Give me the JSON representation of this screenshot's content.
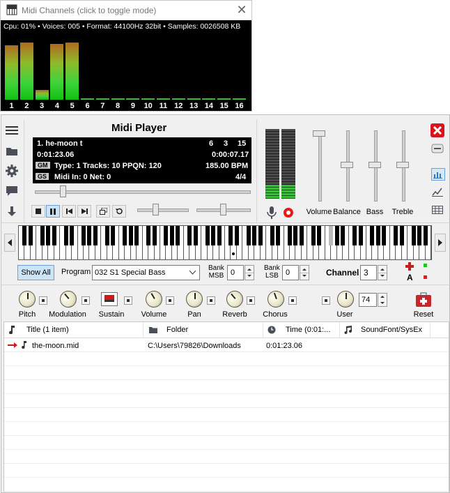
{
  "midi_channels": {
    "title": "Midi Channels (click to toggle mode)",
    "status": "Cpu: 01% • Voices: 005 • Format: 44100Hz 32bit • Samples: 0026508 KB",
    "levels": [
      0.95,
      1.0,
      0.17,
      0.98,
      1.0,
      0,
      0,
      0,
      0,
      0,
      0,
      0,
      0,
      0,
      0,
      0
    ],
    "channels": [
      "1",
      "2",
      "3",
      "4",
      "5",
      "6",
      "7",
      "8",
      "9",
      "10",
      "11",
      "12",
      "13",
      "14",
      "15",
      "16"
    ]
  },
  "player": {
    "title": "Midi Player",
    "song": "1. he-moon   t",
    "nums": [
      "6",
      "3",
      "15"
    ],
    "time_pos": "0:01:23.06",
    "time_remain": "0:00:07.17",
    "gm_tag": "GM",
    "gs_tag": "GS",
    "info_line": "Type: 1  Tracks: 10  PPQN: 120",
    "bpm": "185.00 BPM",
    "midi_line": "Midi In: 0  Net: 0",
    "sig": "4/4",
    "seek_position": 0.12
  },
  "mixer": {
    "labels": [
      "Volume",
      "Balance",
      "Bass",
      "Treble"
    ],
    "positions": [
      0.0,
      0.5,
      0.5,
      0.5
    ]
  },
  "controls": {
    "show_all": "Show All",
    "program_label": "Program",
    "program_value": "032 S1 Special Bass",
    "bank_msb_label": "Bank\nMSB",
    "bank_msb_value": "0",
    "bank_lsb_label": "Bank\nLSB",
    "bank_lsb_value": "0",
    "channel_label": "Channel",
    "channel_value": "3",
    "a_label": "A"
  },
  "knobs": {
    "labels": [
      "Pitch",
      "Modulation",
      "Sustain",
      "Volume",
      "Pan",
      "Reverb",
      "Chorus",
      "User",
      "Reset"
    ],
    "user_value": "74"
  },
  "playlist": {
    "headers": [
      "Title (1 item)",
      "Folder",
      "Time (0:01:...",
      "SoundFont/SysEx"
    ],
    "rows": [
      {
        "title": "the-moon.mid",
        "folder": "C:\\Users\\79826\\Downloads",
        "time": "0:01:23.06",
        "soundfont": ""
      }
    ]
  },
  "colors": {
    "accent": "#2b78c9",
    "close_red": "#d8141c",
    "record_red": "#e21b1b",
    "vu_green": "#31c431"
  }
}
